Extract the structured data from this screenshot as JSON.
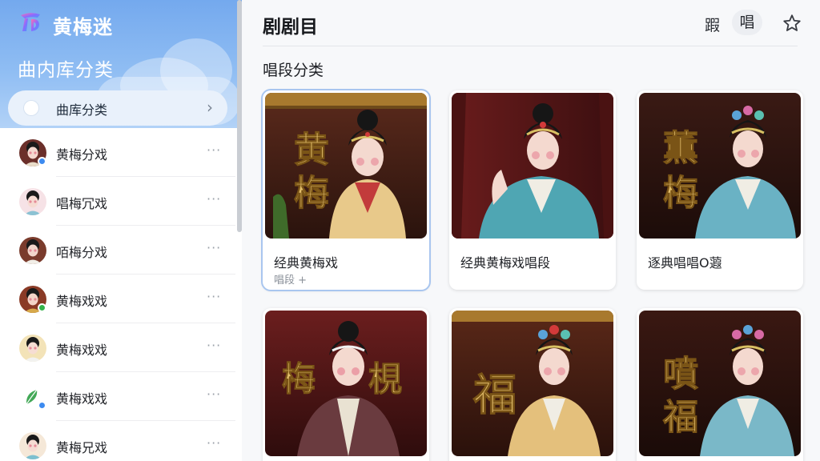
{
  "app": {
    "name": "黄梅迷"
  },
  "sidebar": {
    "section_title": "曲内库分类",
    "active_item": {
      "label": "曲库分类"
    },
    "items": [
      {
        "label": "黄梅分戏",
        "more": "···",
        "badge": "#3d8bf0"
      },
      {
        "label": "唱梅冗戏",
        "more": "···",
        "badge": ""
      },
      {
        "label": "咟梅分戏",
        "more": "···",
        "badge": ""
      },
      {
        "label": "黄梅戏戏",
        "more": "···",
        "badge": "#33b24a"
      },
      {
        "label": "黄梅戏戏",
        "more": "···",
        "badge": ""
      },
      {
        "label": "黄梅戏戏",
        "more": "···",
        "badge": "#3d8bf0"
      },
      {
        "label": "黄梅兄戏",
        "more": "···",
        "badge": ""
      }
    ]
  },
  "main": {
    "title": "剧剧目",
    "header_actions": {
      "button_1": "䠍",
      "button_2": "唱"
    },
    "subtitle": "唱段分类",
    "cards": [
      {
        "title": "经典黄梅戏",
        "subtitle": "唱段 +",
        "calligraphy": [
          "黄",
          "梅"
        ]
      },
      {
        "title": "经典黄梅戏唱段",
        "subtitle": "",
        "calligraphy": []
      },
      {
        "title": "逐典唱唱O蕸",
        "subtitle": "",
        "calligraphy": [
          "薫",
          "梅"
        ]
      },
      {
        "title": "",
        "subtitle": "",
        "calligraphy": [
          "梅",
          "梘"
        ]
      },
      {
        "title": "",
        "subtitle": "",
        "calligraphy": [
          "福"
        ]
      },
      {
        "title": "",
        "subtitle": "",
        "calligraphy": [
          "噴",
          "福"
        ]
      }
    ]
  },
  "colors": {
    "accent": "#74a9ee",
    "selection": "#a9c6ef",
    "calligraphy_gold": "#e2bd6a"
  }
}
